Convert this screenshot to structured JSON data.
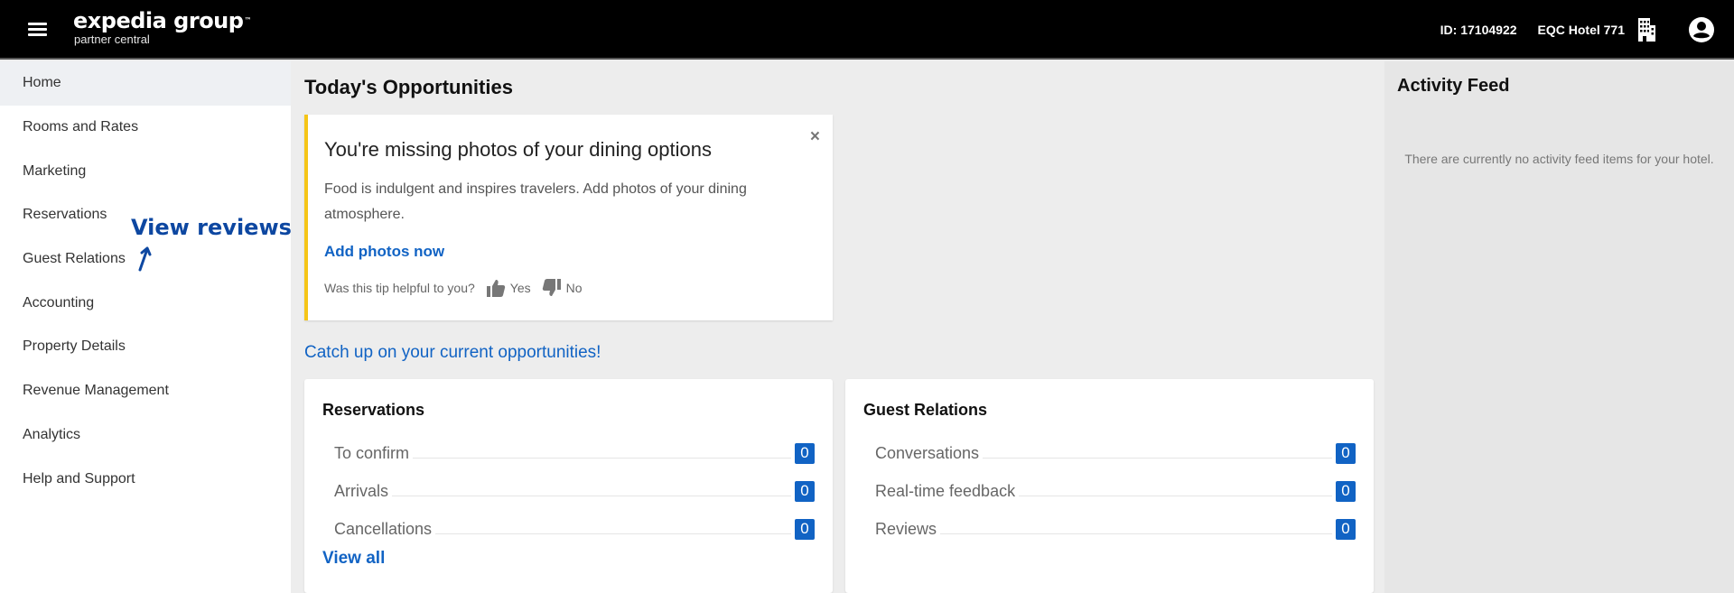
{
  "header": {
    "brand": "expedia group",
    "brand_tm": "™",
    "brand_sub": "partner central",
    "partner_id": "ID: 17104922",
    "hotel_name": "EQC Hotel 771",
    "icons": {
      "menu": "hamburger-icon",
      "property": "building-icon",
      "account": "user-circle-icon"
    }
  },
  "sidebar": {
    "items": [
      {
        "label": "Home",
        "active": true
      },
      {
        "label": "Rooms and Rates"
      },
      {
        "label": "Marketing"
      },
      {
        "label": "Reservations"
      },
      {
        "label": "Guest Relations"
      },
      {
        "label": "Accounting"
      },
      {
        "label": "Property Details"
      },
      {
        "label": "Revenue Management"
      },
      {
        "label": "Analytics"
      },
      {
        "label": "Help and Support"
      }
    ],
    "annotation": {
      "text": "View reviews",
      "color": "#0d47a1"
    }
  },
  "main": {
    "title": "Today's Opportunities",
    "tip": {
      "title": "You're missing photos of your dining options",
      "body": "Food is indulgent and inspires travelers. Add photos of your dining atmosphere.",
      "cta": "Add photos now",
      "close": "×",
      "feedback_question": "Was this tip helpful to you?",
      "yes_label": "Yes",
      "no_label": "No",
      "accent_color": "#f5c518"
    },
    "catchup_link": "Catch up on your current opportunities!",
    "reservations": {
      "title": "Reservations",
      "rows": [
        {
          "label": "To confirm",
          "count": "0"
        },
        {
          "label": "Arrivals",
          "count": "0"
        },
        {
          "label": "Cancellations",
          "count": "0"
        }
      ],
      "view_all": "View all"
    },
    "guest_relations": {
      "title": "Guest Relations",
      "rows": [
        {
          "label": "Conversations",
          "count": "0"
        },
        {
          "label": "Real-time feedback",
          "count": "0"
        },
        {
          "label": "Reviews",
          "count": "0"
        }
      ]
    },
    "link_color": "#1163c4"
  },
  "activity_feed": {
    "title": "Activity Feed",
    "empty_message": "There are currently no activity feed items for your hotel."
  }
}
